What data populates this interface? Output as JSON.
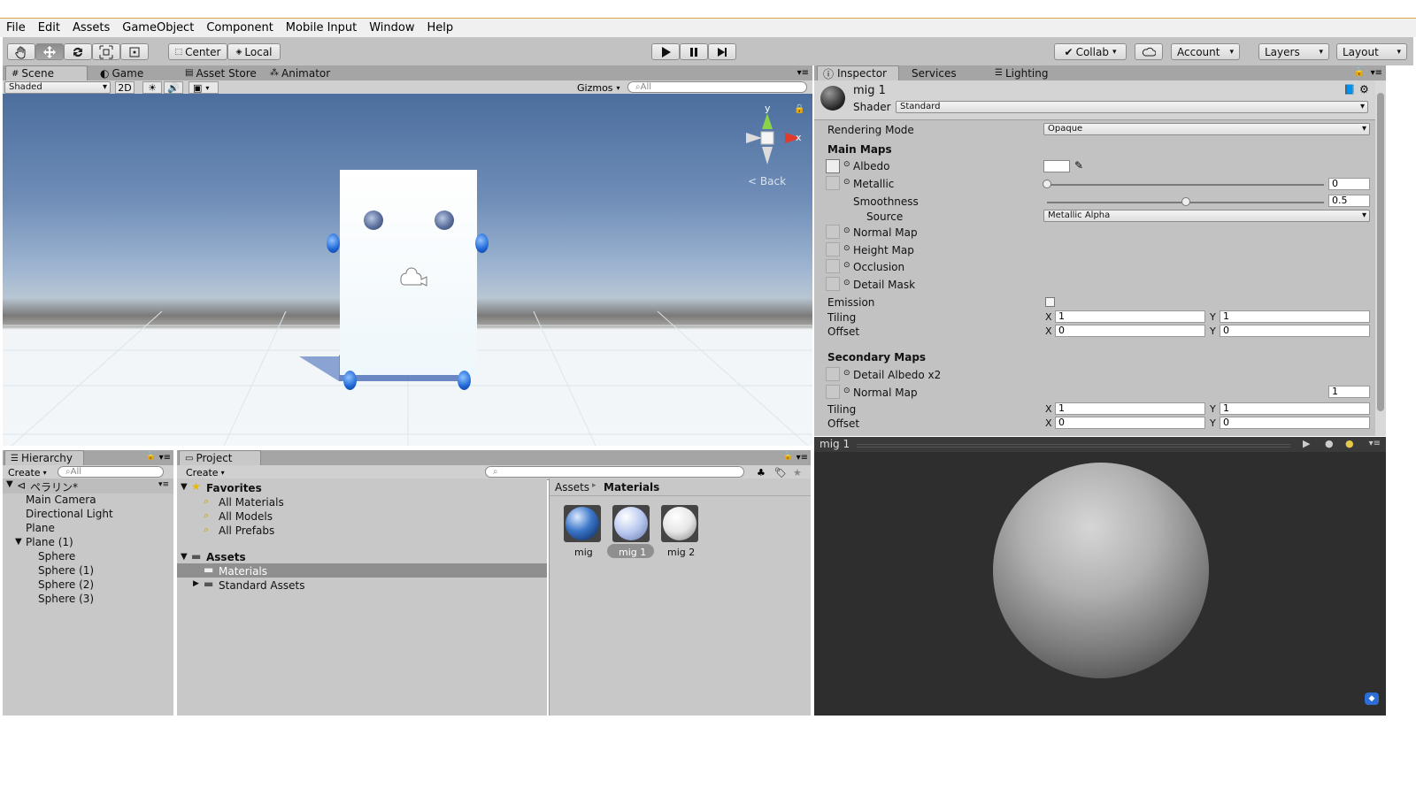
{
  "menu": [
    "File",
    "Edit",
    "Assets",
    "GameObject",
    "Component",
    "Mobile Input",
    "Window",
    "Help"
  ],
  "toolbar": {
    "pivot": "Center",
    "space": "Local",
    "collab": "Collab",
    "account": "Account",
    "layers": "Layers",
    "layout": "Layout"
  },
  "scene_tabs": [
    "Scene",
    "Game",
    "Asset Store",
    "Animator"
  ],
  "scene_bar": {
    "shading": "Shaded",
    "mode_2d": "2D",
    "gizmos": "Gizmos",
    "search_placeholder": "All"
  },
  "gizmo": {
    "y": "y",
    "x": "x",
    "back": "Back"
  },
  "inspector_tabs": [
    "Inspector",
    "Services",
    "Lighting"
  ],
  "inspector": {
    "material_name": "mig 1",
    "shader_label": "Shader",
    "shader_value": "Standard",
    "rendering_mode_label": "Rendering Mode",
    "rendering_mode_value": "Opaque",
    "main_maps": "Main Maps",
    "albedo": "Albedo",
    "metallic": "Metallic",
    "metallic_value": "0",
    "metallic_fraction": 0,
    "smoothness": "Smoothness",
    "smoothness_value": "0.5",
    "smoothness_fraction": 0.5,
    "source": "Source",
    "source_value": "Metallic Alpha",
    "normal_map": "Normal Map",
    "height_map": "Height Map",
    "occlusion": "Occlusion",
    "detail_mask": "Detail Mask",
    "emission": "Emission",
    "tiling": "Tiling",
    "offset": "Offset",
    "axis_x": "X",
    "axis_y": "Y",
    "main_tiling_x": "1",
    "main_tiling_y": "1",
    "main_offset_x": "0",
    "main_offset_y": "0",
    "secondary_maps": "Secondary Maps",
    "detail_albedo": "Detail Albedo x2",
    "secondary_normal_map": "Normal Map",
    "secondary_normal_value": "1",
    "sec_tiling_x": "1",
    "sec_tiling_y": "1",
    "sec_offset_x": "0",
    "sec_offset_y": "0"
  },
  "preview": {
    "title": "mig 1"
  },
  "hierarchy": {
    "tab": "Hierarchy",
    "create": "Create",
    "search_placeholder": "All",
    "scene_name": "ペラリン*",
    "items": [
      {
        "label": "Main Camera",
        "indent": 1
      },
      {
        "label": "Directional Light",
        "indent": 1
      },
      {
        "label": "Plane",
        "indent": 1
      },
      {
        "label": "Plane (1)",
        "indent": 1,
        "expanded": true
      },
      {
        "label": "Sphere",
        "indent": 2
      },
      {
        "label": "Sphere (1)",
        "indent": 2
      },
      {
        "label": "Sphere (2)",
        "indent": 2
      },
      {
        "label": "Sphere (3)",
        "indent": 2
      }
    ]
  },
  "project": {
    "tab": "Project",
    "create": "Create",
    "favorites": "Favorites",
    "favorite_items": [
      "All Materials",
      "All Models",
      "All Prefabs"
    ],
    "assets": "Assets",
    "asset_folders": [
      "Materials",
      "Standard Assets"
    ],
    "breadcrumb": [
      "Assets",
      "Materials"
    ],
    "materials": [
      "mig",
      "mig 1",
      "mig 2"
    ]
  }
}
